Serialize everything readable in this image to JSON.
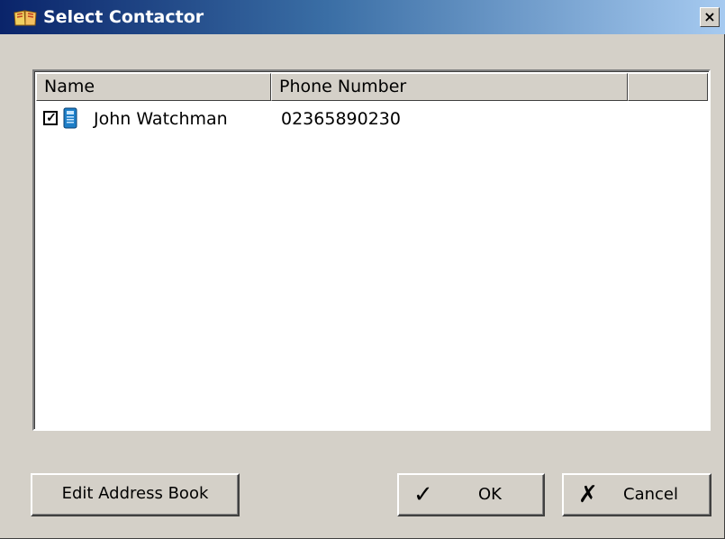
{
  "window": {
    "title": "Select Contactor",
    "close_glyph": "×",
    "title_icon": "book-icon"
  },
  "list": {
    "columns": [
      "Name",
      "Phone Number",
      ""
    ],
    "rows": [
      {
        "checked": true,
        "check_glyph": "✓",
        "icon": "phone-icon",
        "name": "John Watchman",
        "phone": "02365890230"
      }
    ]
  },
  "buttons": {
    "edit_label": "Edit Address Book",
    "ok_label": "OK",
    "ok_glyph": "✓",
    "cancel_label": "Cancel",
    "cancel_glyph": "✗"
  }
}
